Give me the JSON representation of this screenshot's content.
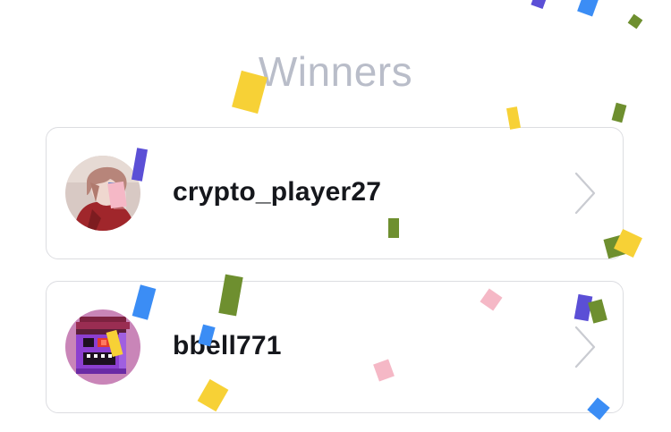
{
  "header": {
    "title": "Winners"
  },
  "winners": [
    {
      "username": "crypto_player27",
      "avatar_icon": "anime-character-avatar-icon"
    },
    {
      "username": "bbell771",
      "avatar_icon": "pixel-art-avatar-icon"
    }
  ],
  "colors": {
    "title": "#b9bdc9",
    "username": "#15171c",
    "card_border": "#dcdde1",
    "chevron": "#c9cbd1",
    "confetti": [
      "#f7d136",
      "#5b4fd6",
      "#3b8df5",
      "#6e8f2f",
      "#f5b8c6"
    ]
  }
}
